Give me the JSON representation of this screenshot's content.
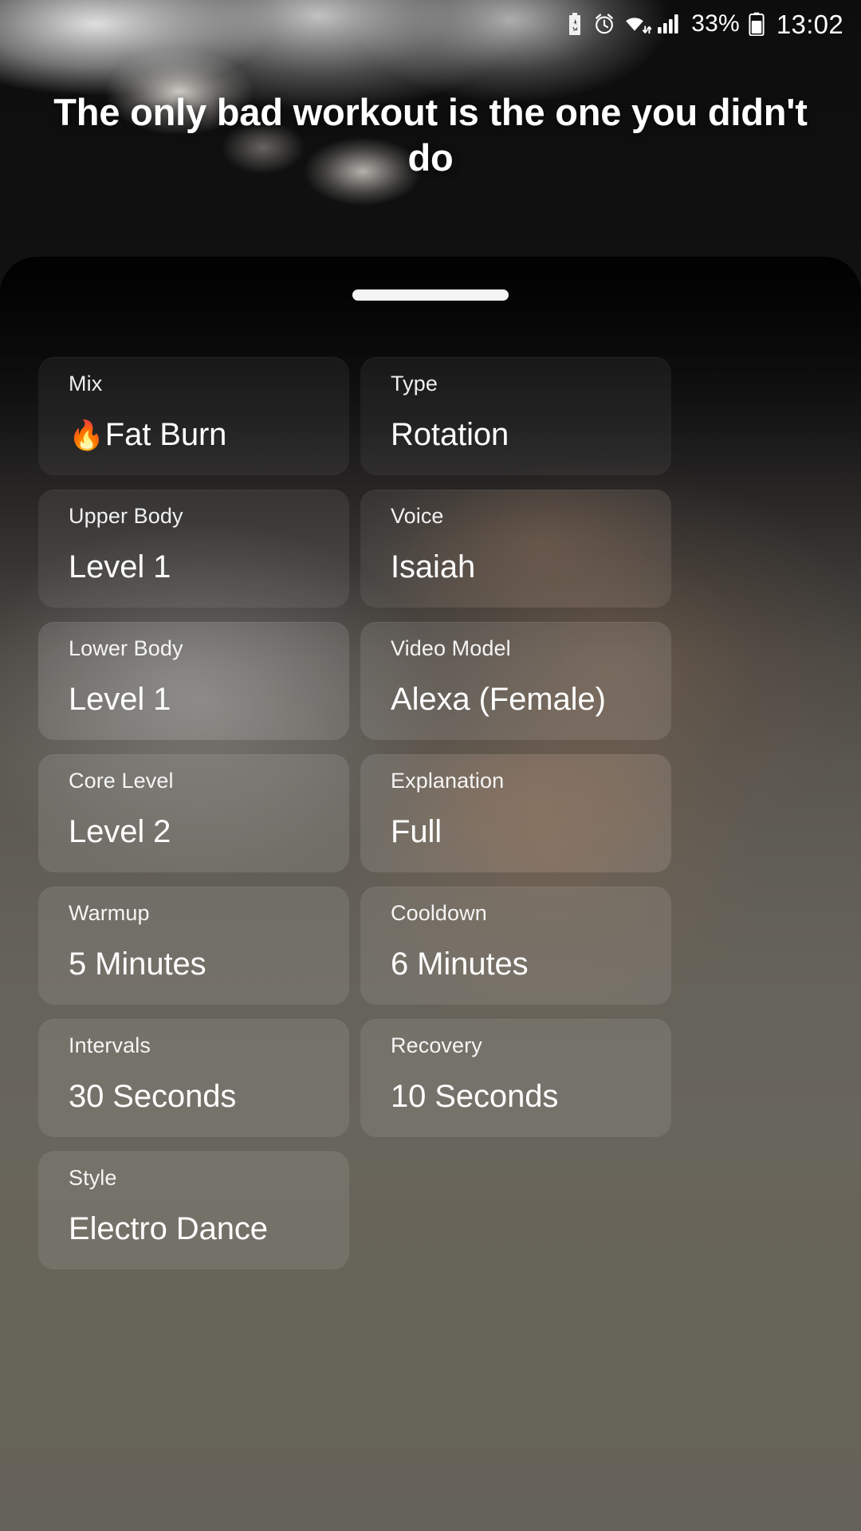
{
  "statusbar": {
    "battery_percent": "33%",
    "time": "13:02",
    "icons": [
      "battery-saver-icon",
      "alarm-icon",
      "wifi-icon",
      "signal-icon",
      "battery-icon"
    ]
  },
  "hero": {
    "quote": "The only bad workout is the one you didn't do"
  },
  "sheet": {
    "drag_handle": "drag-handle"
  },
  "settings": {
    "cards": [
      {
        "label": "Mix",
        "value": "Fat Burn",
        "emoji": "🔥"
      },
      {
        "label": "Type",
        "value": "Rotation",
        "emoji": ""
      },
      {
        "label": "Upper Body",
        "value": "Level 1",
        "emoji": ""
      },
      {
        "label": "Voice",
        "value": "Isaiah",
        "emoji": ""
      },
      {
        "label": "Lower Body",
        "value": "Level 1",
        "emoji": ""
      },
      {
        "label": "Video Model",
        "value": "Alexa (Female)",
        "emoji": ""
      },
      {
        "label": "Core Level",
        "value": "Level 2",
        "emoji": ""
      },
      {
        "label": "Explanation",
        "value": "Full",
        "emoji": ""
      },
      {
        "label": "Warmup",
        "value": "5 Minutes",
        "emoji": ""
      },
      {
        "label": "Cooldown",
        "value": "6 Minutes",
        "emoji": ""
      },
      {
        "label": "Intervals",
        "value": "30 Seconds",
        "emoji": ""
      },
      {
        "label": "Recovery",
        "value": "10 Seconds",
        "emoji": ""
      },
      {
        "label": "Style",
        "value": "Electro Dance",
        "emoji": ""
      }
    ]
  },
  "colors": {
    "text_primary": "#ffffff",
    "text_label": "#eeeeee",
    "sheet_top": "#0a0a0b",
    "sheet_bottom": "#656259",
    "handle": "#f4f4f4"
  }
}
